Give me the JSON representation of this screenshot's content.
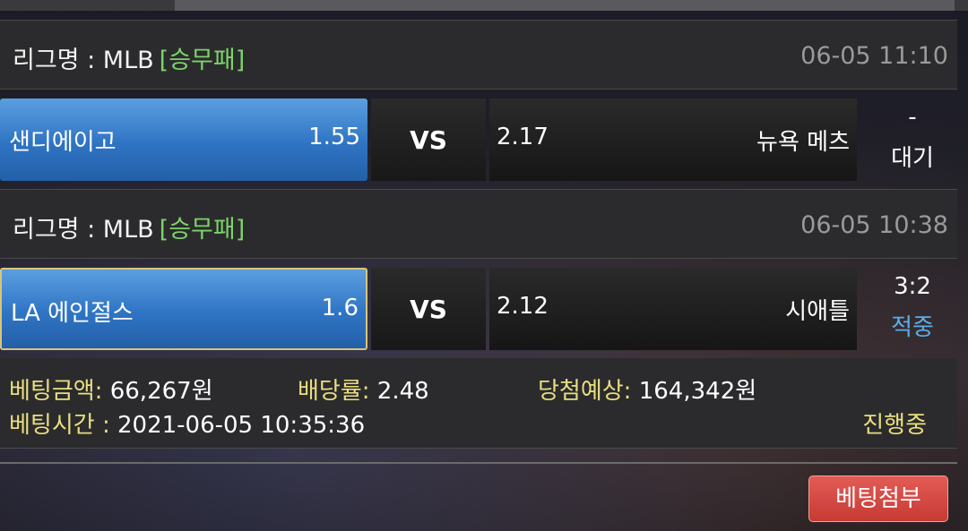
{
  "matches": [
    {
      "league_label": "리그명 : MLB",
      "bet_type": "[승무패]",
      "datetime": "06-05 11:10",
      "home_team": "샌디에이고",
      "home_odds": "1.55",
      "vs_label": "VS",
      "away_odds": "2.17",
      "away_team": "뉴욕 메츠",
      "score": "-",
      "status": "대기",
      "selected": "home"
    },
    {
      "league_label": "리그명 : MLB",
      "bet_type": "[승무패]",
      "datetime": "06-05 10:38",
      "home_team": "LA 에인절스",
      "home_odds": "1.6",
      "vs_label": "VS",
      "away_odds": "2.12",
      "away_team": "시애틀",
      "score": "3:2",
      "status": "적중",
      "selected": "home"
    }
  ],
  "summary": {
    "bet_amount_label": "베팅금액:",
    "bet_amount": "66,267원",
    "odds_label": "배당률:",
    "odds": "2.48",
    "expected_label": "당첨예상:",
    "expected": "164,342원",
    "bet_time_label": "베팅시간 :",
    "bet_time": "2021-06-05 10:35:36",
    "progress_status": "진행중"
  },
  "actions": {
    "attach_button": "베팅첨부"
  },
  "colors": {
    "home_blue": "#2f74c4",
    "bet_type_green": "#7dd36a",
    "label_yellow": "#e9df80",
    "hit_blue": "#5aaee8",
    "button_red": "#d4443e"
  }
}
